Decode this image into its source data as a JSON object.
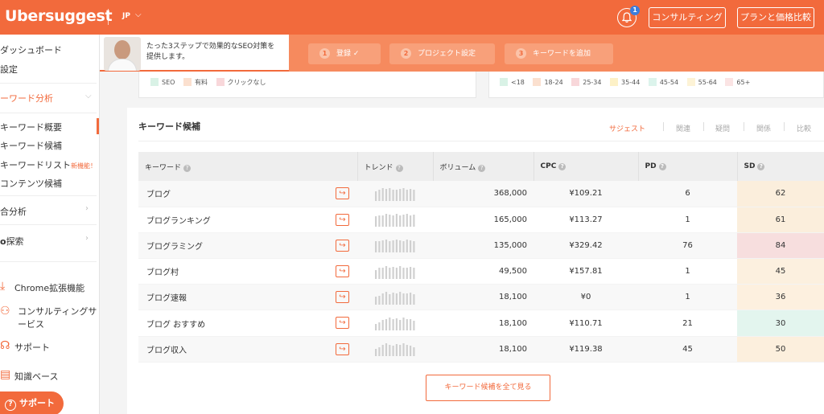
{
  "header": {
    "logo": "Ubersuggest",
    "language": "JP",
    "notification_count": "1",
    "consulting_label": "コンサルティング",
    "plans_label": "プランと価格比較"
  },
  "sidebar": {
    "items": [
      {
        "label": "ダッシュボード"
      },
      {
        "label": "設定"
      },
      {
        "label": "ーワード分析"
      },
      {
        "label": "キーワード概要"
      },
      {
        "label": "キーワード候補"
      },
      {
        "label": "キーワードリスト",
        "badge": "新機能！"
      },
      {
        "label": "コンテンツ候補"
      },
      {
        "label": "合分析"
      },
      {
        "label": "探索"
      },
      {
        "label": "Chrome拡張機能"
      },
      {
        "label": "コンサルティングサ"
      },
      {
        "label": "ービス"
      },
      {
        "label": "サポート"
      },
      {
        "label": "知識ベース"
      }
    ],
    "support_button": "サポート"
  },
  "banner": {
    "text_line1": "たった3ステップで効果的なSEO対策を",
    "text_line2": "提供します。",
    "steps": [
      {
        "num": "1",
        "label": "登録 ✓"
      },
      {
        "num": "2",
        "label": "プロジェクト設定"
      },
      {
        "num": "3",
        "label": "キーワードを追加"
      }
    ]
  },
  "legend_clicks": [
    {
      "label": "SEO",
      "color": "#d9f2e6"
    },
    {
      "label": "有料",
      "color": "#fbe0cf"
    },
    {
      "label": "クリックなし",
      "color": "#f8d7da"
    }
  ],
  "legend_ages": [
    {
      "label": "<18",
      "color": "#d9f2e6"
    },
    {
      "label": "18-24",
      "color": "#fbe0cf"
    },
    {
      "label": "25-34",
      "color": "#f8d7da"
    },
    {
      "label": "35-44",
      "color": "#fdf1c7"
    },
    {
      "label": "45-54",
      "color": "#dcf4ec"
    },
    {
      "label": "55-64",
      "color": "#fdf3d6"
    },
    {
      "label": "65+",
      "color": "#fbe4e4"
    }
  ],
  "panel": {
    "title": "キーワード候補",
    "tabs": [
      "サジェスト",
      "関連",
      "疑問",
      "関係",
      "比較"
    ],
    "active_tab": "サジェスト",
    "columns": [
      "キーワード",
      "トレンド",
      "ボリューム",
      "CPC",
      "PD",
      "SD"
    ],
    "rows": [
      {
        "keyword": "ブログ",
        "trend": [
          0.75,
          0.9,
          1.0,
          0.95,
          1.0,
          0.9,
          0.85,
          0.95,
          1.0,
          0.9,
          0.95,
          0.85
        ],
        "volume": "368,000",
        "cpc": "¥109.21",
        "pd": "6",
        "sd": "62",
        "sd_color": "#fbeedc"
      },
      {
        "keyword": "ブログランキング",
        "trend": [
          0.8,
          0.85,
          0.9,
          1.0,
          0.95,
          0.9,
          1.0,
          0.9,
          0.95,
          1.0,
          0.9,
          0.95
        ],
        "volume": "165,000",
        "cpc": "¥113.27",
        "pd": "1",
        "sd": "61",
        "sd_color": "#fbeedc"
      },
      {
        "keyword": "ブログラミング",
        "trend": [
          0.85,
          0.9,
          0.95,
          1.0,
          0.9,
          0.95,
          1.0,
          0.95,
          0.9,
          1.0,
          0.95,
          0.9
        ],
        "volume": "135,000",
        "cpc": "¥329.42",
        "pd": "76",
        "sd": "84",
        "sd_color": "#f7dede"
      },
      {
        "keyword": "ブログ村",
        "trend": [
          0.7,
          0.85,
          0.9,
          1.0,
          0.85,
          0.95,
          0.9,
          1.0,
          0.85,
          0.9,
          0.95,
          0.85
        ],
        "volume": "49,500",
        "cpc": "¥157.81",
        "pd": "1",
        "sd": "45",
        "sd_color": "#fcf0df"
      },
      {
        "keyword": "ブログ速報",
        "trend": [
          0.6,
          0.7,
          0.9,
          1.0,
          0.8,
          0.95,
          0.85,
          1.0,
          0.9,
          0.85,
          0.95,
          0.8
        ],
        "volume": "18,100",
        "cpc": "¥0",
        "pd": "1",
        "sd": "36",
        "sd_color": "#fdf0df"
      },
      {
        "keyword": "ブログ おすすめ",
        "trend": [
          0.5,
          0.65,
          0.8,
          0.9,
          1.0,
          0.85,
          0.95,
          0.8,
          1.0,
          0.9,
          0.85,
          0.75
        ],
        "volume": "18,100",
        "cpc": "¥110.71",
        "pd": "21",
        "sd": "30",
        "sd_color": "#e3f5ee"
      },
      {
        "keyword": "ブログ収入",
        "trend": [
          0.55,
          0.7,
          0.85,
          1.0,
          0.9,
          0.8,
          0.95,
          0.85,
          1.0,
          0.9,
          0.8,
          0.7
        ],
        "volume": "18,100",
        "cpc": "¥119.38",
        "pd": "45",
        "sd": "50",
        "sd_color": "#fcefdd"
      }
    ],
    "view_all_label": "キーワード候補を全て見る"
  }
}
